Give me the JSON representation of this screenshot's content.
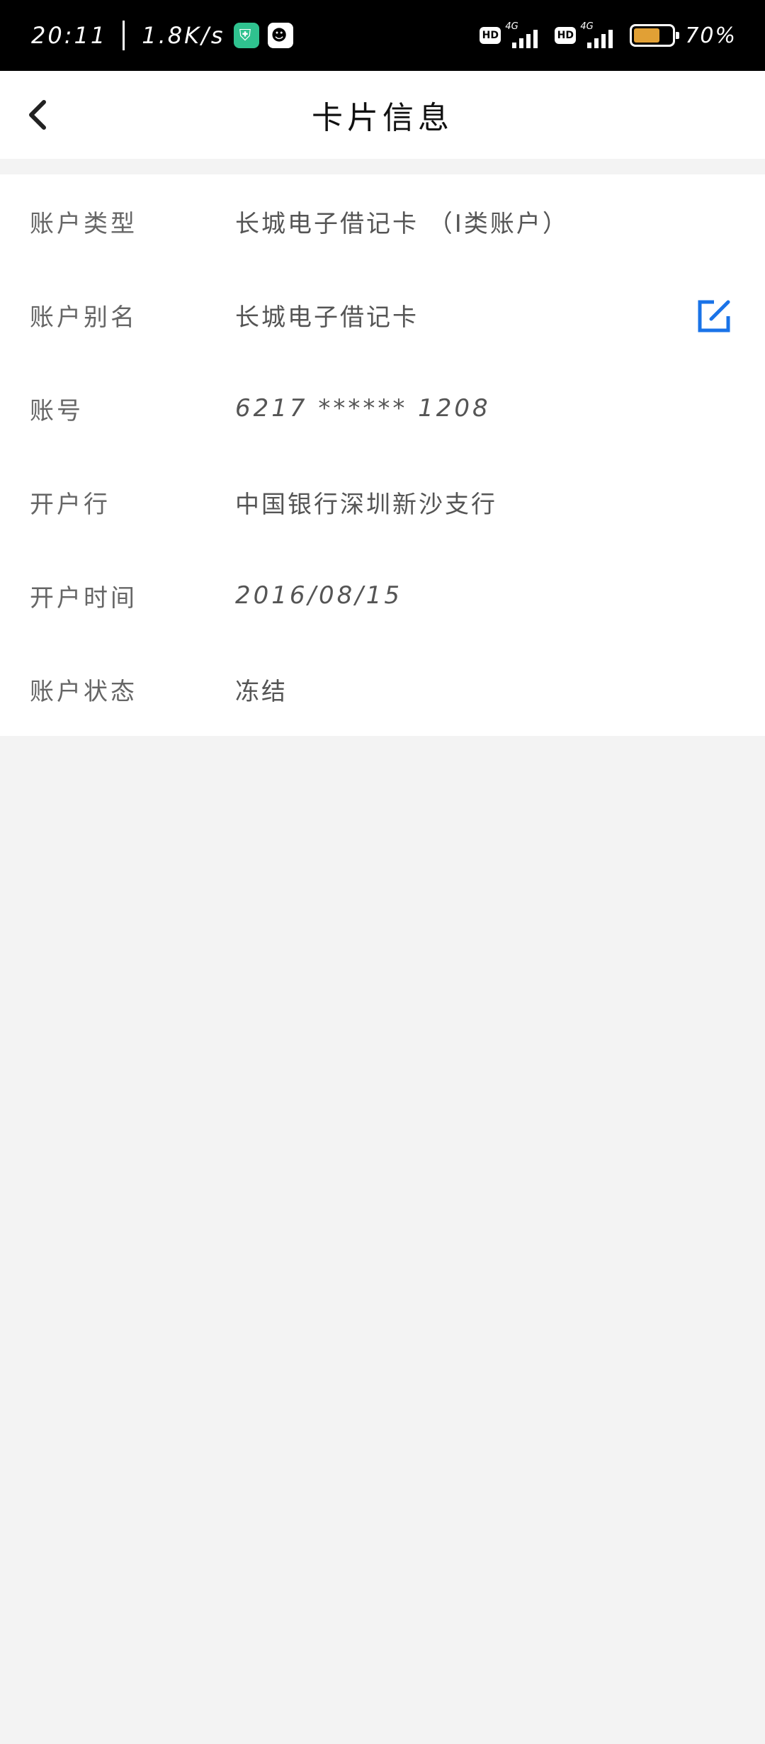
{
  "status_bar": {
    "time": "20:11",
    "net_speed": "1.8K/s",
    "hd1": "HD",
    "net1": "4G",
    "hd2": "HD",
    "net2": "4G",
    "battery_percent": 70,
    "battery_text": "70%",
    "battery_color": "#e1a035"
  },
  "header": {
    "title": "卡片信息",
    "back_icon": "chevron-left-icon"
  },
  "card_info": {
    "rows": [
      {
        "label": "账户类型",
        "value": "长城电子借记卡 （I类账户）"
      },
      {
        "label": "账户别名",
        "value": "长城电子借记卡"
      },
      {
        "label": "账号",
        "value": "6217 ****** 1208"
      },
      {
        "label": "开户行",
        "value": "中国银行深圳新沙支行"
      },
      {
        "label": "开户时间",
        "value": "2016/08/15"
      },
      {
        "label": "账户状态",
        "value": "冻结"
      }
    ],
    "edit_icon": "edit-icon",
    "accent_color": "#1a73e8"
  }
}
